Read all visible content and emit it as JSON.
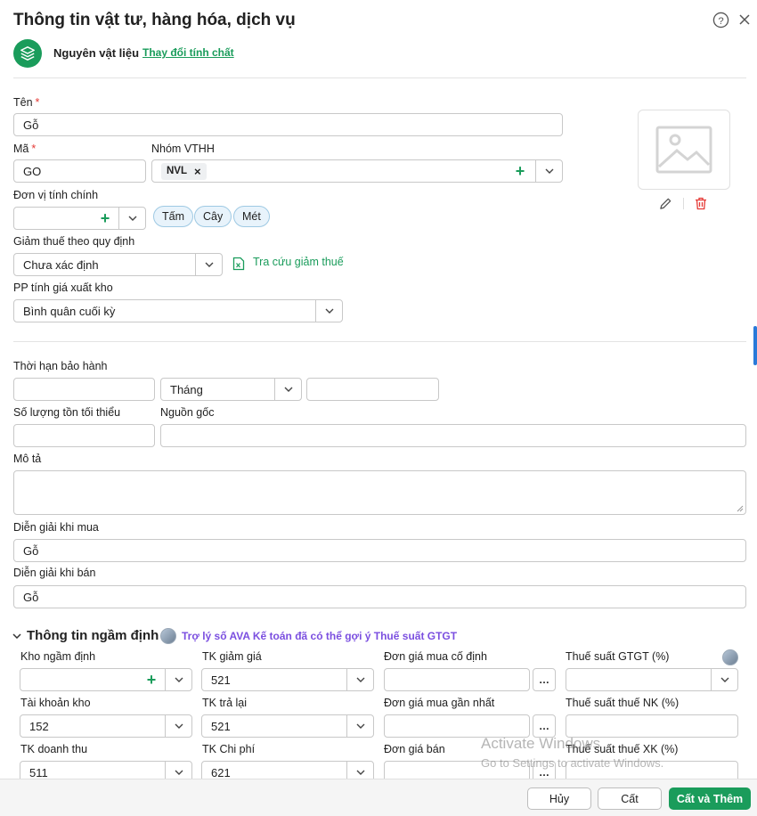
{
  "dialog": {
    "title": "Thông tin vật tư, hàng hóa, dịch vụ",
    "type_label": "Nguyên vật liệu",
    "change_link": "Thay đổi tính chất"
  },
  "fields": {
    "ten": {
      "label": "Tên",
      "value": "Gỗ"
    },
    "ma": {
      "label": "Mã",
      "value": "GO"
    },
    "nhom_vthh": {
      "label": "Nhóm VTHH",
      "tags": [
        "NVL"
      ]
    },
    "don_vi": {
      "label": "Đơn vị tính chính",
      "value": "",
      "chips": [
        "Tấm",
        "Cây",
        "Mét"
      ]
    },
    "giam_thue": {
      "label": "Giảm thuế theo quy định",
      "value": "Chưa xác định",
      "lookup_link": "Tra cứu giảm thuế"
    },
    "pp_tinh_gia": {
      "label": "PP tính giá xuất kho",
      "value": "Bình quân cuối kỳ"
    },
    "bao_hanh": {
      "label": "Thời hạn bảo hành",
      "value": "",
      "unit": "Tháng",
      "extra": ""
    },
    "ton_toi_thieu": {
      "label": "Số lượng tồn tối thiểu",
      "value": ""
    },
    "nguon_goc": {
      "label": "Nguồn gốc",
      "value": ""
    },
    "mo_ta": {
      "label": "Mô tả",
      "value": ""
    },
    "dien_giai_mua": {
      "label": "Diễn giải khi mua",
      "value": "Gỗ"
    },
    "dien_giai_ban": {
      "label": "Diễn giải khi bán",
      "value": "Gỗ"
    }
  },
  "defaults": {
    "title": "Thông tin ngầm định",
    "ava_hint": "Trợ lý số AVA Kế toán đã có thể gợi ý Thuế suất GTGT",
    "kho": {
      "label": "Kho ngầm định",
      "value": ""
    },
    "tk_giam_gia": {
      "label": "TK giảm giá",
      "value": "521"
    },
    "don_gia_mua_co_dinh": {
      "label": "Đơn giá mua cố định",
      "value": ""
    },
    "thue_gtgt": {
      "label": "Thuế suất GTGT (%)",
      "value": ""
    },
    "tk_kho": {
      "label": "Tài khoản kho",
      "value": "152"
    },
    "tk_tra_lai": {
      "label": "TK trả lại",
      "value": "521"
    },
    "don_gia_mua_gan_nhat": {
      "label": "Đơn giá mua gần nhất",
      "value": ""
    },
    "thue_nk": {
      "label": "Thuế suất thuế NK (%)",
      "value": ""
    },
    "tk_doanh_thu": {
      "label": "TK doanh thu",
      "value": "511"
    },
    "tk_chi_phi": {
      "label": "TK Chi phí",
      "value": "621"
    },
    "don_gia_ban": {
      "label": "Đơn giá bán",
      "value": ""
    },
    "thue_xk": {
      "label": "Thuế suất thuế XK (%)",
      "value": ""
    }
  },
  "footer": {
    "cancel": "Hủy",
    "save": "Cất",
    "save_add": "Cất và Thêm"
  },
  "watermark": {
    "line1": "Activate Windows",
    "line2": "Go to Settings to activate Windows."
  },
  "colors": {
    "accent": "#1a9c5b",
    "required": "#e53935",
    "ava": "#7b4fe0"
  }
}
